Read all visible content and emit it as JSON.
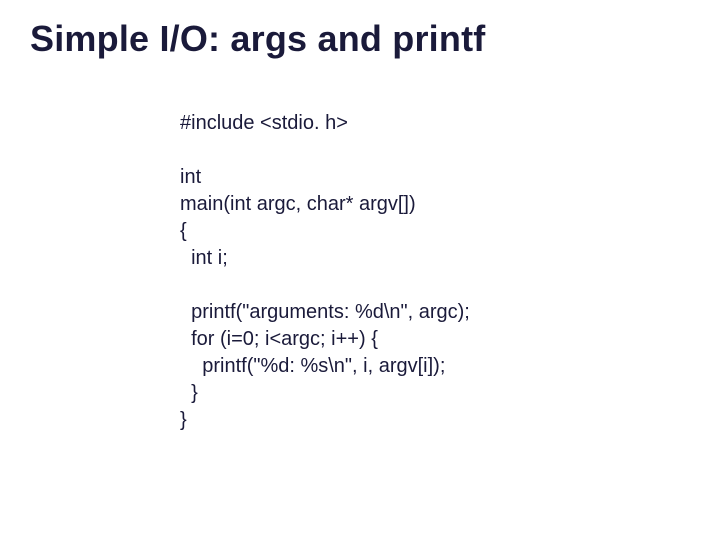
{
  "title": "Simple I/O: args and printf",
  "code": "#include <stdio. h>\n\nint\nmain(int argc, char* argv[])\n{\n  int i;\n\n  printf(\"arguments: %d\\n\", argc);\n  for (i=0; i<argc; i++) {\n    printf(\"%d: %s\\n\", i, argv[i]);\n  }\n}"
}
